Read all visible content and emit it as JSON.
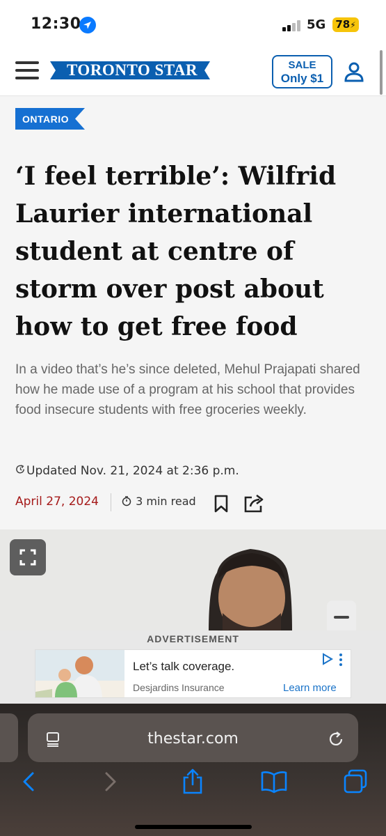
{
  "status_bar": {
    "time": "12:30",
    "network": "5G",
    "battery": "78"
  },
  "header": {
    "logo_text": "TORONTO STAR",
    "sale_line1": "SALE",
    "sale_line2": "Only $1"
  },
  "article": {
    "section": "ONTARIO",
    "headline": "‘I feel terrible’: Wilfrid Laurier international student at centre of storm over post about how to get free food",
    "deck": "In a video that’s he’s since deleted, Mehul Prajapati shared how he made use of a program at his school that provides food insecure students with free groceries weekly.",
    "updated": "Updated Nov. 21, 2024 at 2:36 p.m.",
    "published": "April 27, 2024",
    "read_time": "3 min read"
  },
  "ad": {
    "label": "ADVERTISEMENT",
    "headline": "Let’s talk coverage.",
    "sponsor": "Desjardins Insurance",
    "cta": "Learn more"
  },
  "browser": {
    "url": "thestar.com"
  },
  "colors": {
    "brand_blue": "#0b5fb0",
    "tag_blue": "#1670d2",
    "date_red": "#a51a1a",
    "link_blue": "#1a73c8",
    "safari_blue": "#0a84ff"
  }
}
